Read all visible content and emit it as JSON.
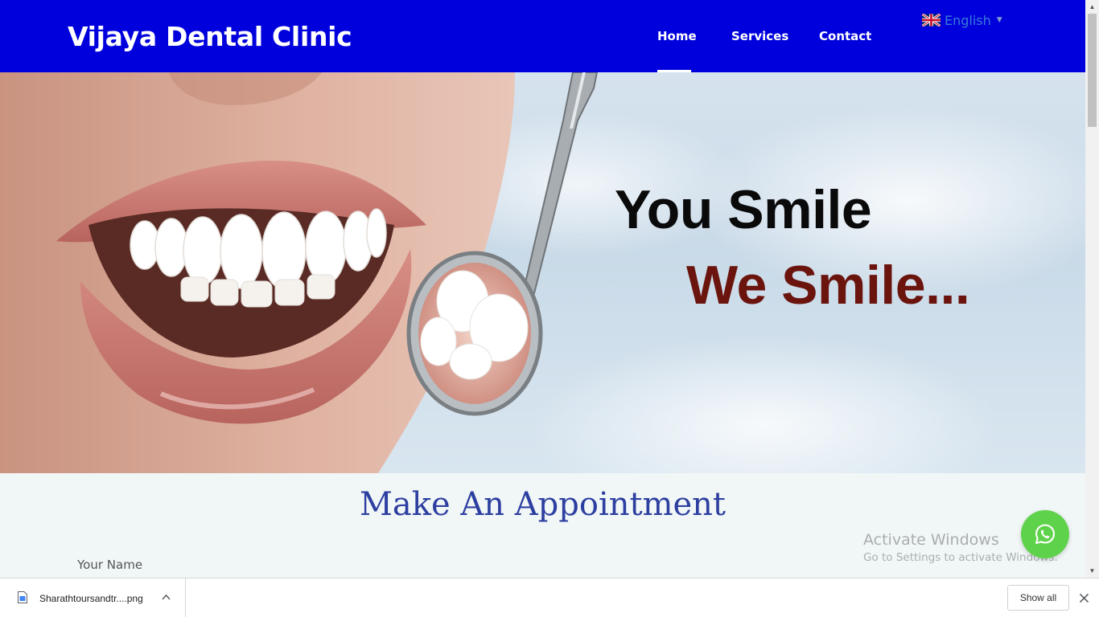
{
  "header": {
    "brand": "Vijaya Dental Clinic",
    "nav": [
      {
        "label": "Home",
        "active": true
      },
      {
        "label": "Services",
        "active": false
      },
      {
        "label": "Contact",
        "active": false
      }
    ],
    "language": {
      "label": "English",
      "icon": "uk-flag-icon"
    },
    "background_color": "#0000dd"
  },
  "hero": {
    "tagline_line1": "You Smile",
    "tagline_line2": "We Smile...",
    "tagline_line2_color": "#6b140e"
  },
  "appointment": {
    "title": "Make An Appointment",
    "name_label": "Your Name"
  },
  "watermark": {
    "line1": "Activate Windows",
    "line2": "Go to Settings to activate Windows."
  },
  "whatsapp": {
    "icon": "whatsapp-icon",
    "color": "#5fd24b"
  },
  "download_bar": {
    "file_name": "Sharathtoursandtr....png",
    "show_all": "Show all"
  }
}
